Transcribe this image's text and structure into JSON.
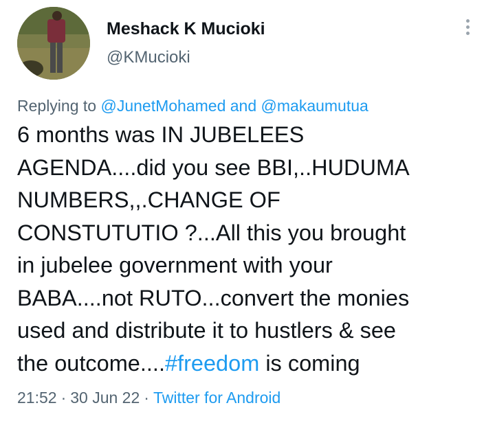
{
  "tweet": {
    "author_name": "Meshack K Mucioki",
    "author_handle": "@KMucioki",
    "avatar_icon": "profile-photo",
    "more_icon": "vertical-ellipsis-icon",
    "replying_prefix": "Replying to",
    "reply_to_1": "@JunetMohamed",
    "reply_and": "and",
    "reply_to_2": "@makaumutua",
    "body_lines": [
      "6 months was IN JUBELEES",
      "AGENDA....did you see BBI,..HUDUMA",
      "NUMBERS,,.CHANGE OF",
      "CONSTUTUTIO ?...All this you brought",
      "in jubelee government with your",
      "BABA....not RUTO...convert the monies",
      "used and distribute it to hustlers & see"
    ],
    "last_line_prefix": "the outcome....",
    "hashtag": "#freedom",
    "last_line_suffix": " is coming",
    "time": "21:52",
    "date": "30 Jun 22",
    "source": "Twitter for Android",
    "separator": "·"
  },
  "colors": {
    "text": "#0f1419",
    "secondary": "#536471",
    "link": "#1d9bf0"
  }
}
